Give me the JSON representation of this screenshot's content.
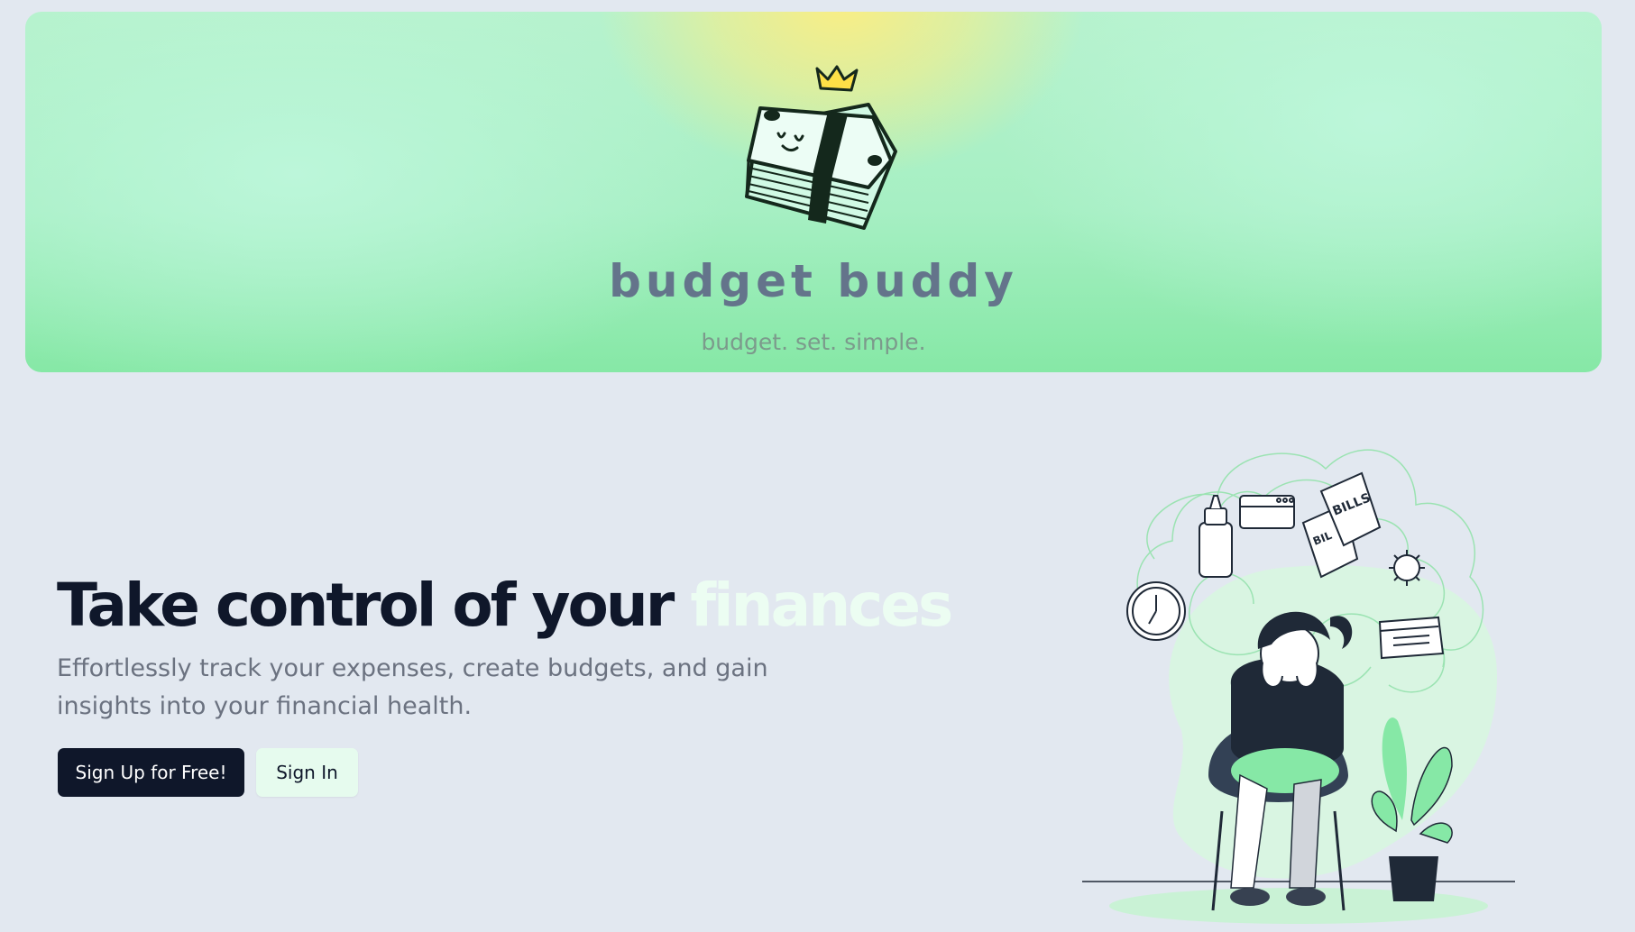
{
  "hero": {
    "title": "budget buddy",
    "tagline": "budget. set. simple."
  },
  "main": {
    "headline_prefix": "Take control of your ",
    "headline_accent": "finances",
    "subtext": "Effortlessly track your expenses, create budgets, and gain insights into your financial health.",
    "primary_button": "Sign Up for Free!",
    "secondary_button": "Sign In"
  },
  "illustration": {
    "bills_label": "BILLS",
    "bills_label_back": "BIL"
  },
  "colors": {
    "background": "#e2e8f0",
    "banner_green": "#a6efc3",
    "banner_yellow": "#fded80",
    "primary_dark": "#0f172a",
    "accent_mint": "#ecfdf2",
    "muted_text": "#6b7280",
    "title_slate": "#64748b"
  },
  "icons": [
    "money-stack-logo-icon",
    "crown-icon",
    "baby-bottle-icon",
    "credit-card-icon",
    "bills-icon",
    "virus-icon",
    "clock-icon",
    "calendar-icon",
    "plant-icon"
  ]
}
